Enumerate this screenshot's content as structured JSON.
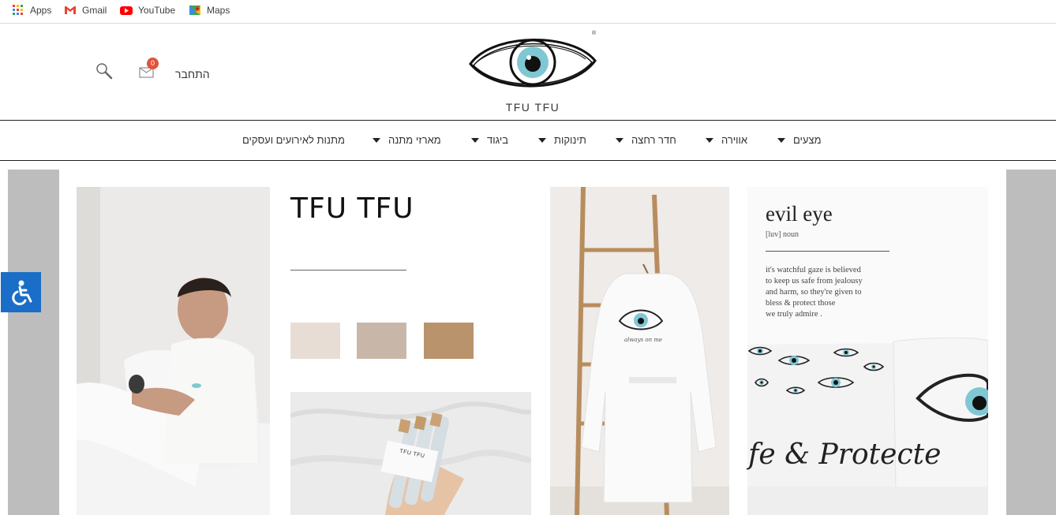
{
  "bookmarks": [
    {
      "label": "Apps",
      "icon": "apps-grid-icon"
    },
    {
      "label": "Gmail",
      "icon": "gmail-icon"
    },
    {
      "label": "YouTube",
      "icon": "youtube-icon"
    },
    {
      "label": "Maps",
      "icon": "maps-icon"
    }
  ],
  "header": {
    "login_label": "התחבר",
    "cart_count": "0",
    "brand": "TFU TFU",
    "registered_mark": "®"
  },
  "nav": [
    {
      "label": "מצעים"
    },
    {
      "label": "אווירה"
    },
    {
      "label": "חדר רחצה"
    },
    {
      "label": "תינוקות"
    },
    {
      "label": "ביגוד"
    },
    {
      "label": "מארזי מתנה"
    },
    {
      "label": "מתנות לאירועים ועסקים"
    }
  ],
  "collage": {
    "title": "TFU TFU",
    "swatch_colors": [
      "#e8ddd4",
      "#c8b7a8",
      "#b8936c"
    ],
    "tube_label": "TFU TFU",
    "robe_script": "always on me",
    "evil_eye": {
      "title": "evil eye",
      "pronunciation": "[luv] noun",
      "lines": [
        "it's watchful gaze is believed",
        "to keep us safe from jealousy",
        "and harm, so they're given to",
        "bless & protect those",
        "we truly admire ."
      ],
      "pillow_script": "fe & Protecte"
    }
  },
  "colors": {
    "accent_blue": "#1a6ec7",
    "badge_red": "#e0533b",
    "eye_turquoise": "#7fc8d3"
  }
}
